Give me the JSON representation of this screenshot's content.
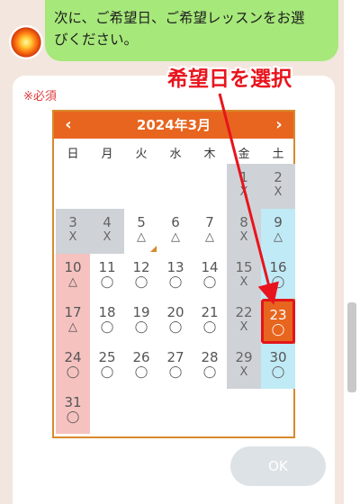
{
  "chat": {
    "message_line1": "次に、ご希望日、ご希望レッスンをお選",
    "message_line2": "びください。"
  },
  "annotation": {
    "text": "希望日を選択",
    "color": "#e8141d"
  },
  "form": {
    "required_label": "※必須"
  },
  "calendar": {
    "title": "2024年3月",
    "prev": "‹",
    "next": "›",
    "weekdays": [
      "日",
      "月",
      "火",
      "水",
      "木",
      "金",
      "土"
    ],
    "days": [
      {
        "d": "1",
        "m": "X",
        "row": 0,
        "col": 5,
        "state": "gray"
      },
      {
        "d": "2",
        "m": "X",
        "row": 0,
        "col": 6,
        "state": "gray"
      },
      {
        "d": "3",
        "m": "X",
        "row": 1,
        "col": 0,
        "state": "gray"
      },
      {
        "d": "4",
        "m": "X",
        "row": 1,
        "col": 1,
        "state": "gray"
      },
      {
        "d": "5",
        "m": "△",
        "row": 1,
        "col": 2,
        "state": "normal"
      },
      {
        "d": "6",
        "m": "△",
        "row": 1,
        "col": 3,
        "state": "normal"
      },
      {
        "d": "7",
        "m": "△",
        "row": 1,
        "col": 4,
        "state": "normal"
      },
      {
        "d": "8",
        "m": "X",
        "row": 1,
        "col": 5,
        "state": "gray"
      },
      {
        "d": "9",
        "m": "△",
        "row": 1,
        "col": 6,
        "state": "blue"
      },
      {
        "d": "10",
        "m": "△",
        "row": 2,
        "col": 0,
        "state": "pink"
      },
      {
        "d": "11",
        "m": "◯",
        "row": 2,
        "col": 1,
        "state": "normal"
      },
      {
        "d": "12",
        "m": "◯",
        "row": 2,
        "col": 2,
        "state": "normal"
      },
      {
        "d": "13",
        "m": "◯",
        "row": 2,
        "col": 3,
        "state": "normal"
      },
      {
        "d": "14",
        "m": "◯",
        "row": 2,
        "col": 4,
        "state": "normal"
      },
      {
        "d": "15",
        "m": "X",
        "row": 2,
        "col": 5,
        "state": "gray"
      },
      {
        "d": "16",
        "m": "◯",
        "row": 2,
        "col": 6,
        "state": "blue"
      },
      {
        "d": "17",
        "m": "△",
        "row": 3,
        "col": 0,
        "state": "pink"
      },
      {
        "d": "18",
        "m": "◯",
        "row": 3,
        "col": 1,
        "state": "normal"
      },
      {
        "d": "19",
        "m": "◯",
        "row": 3,
        "col": 2,
        "state": "normal"
      },
      {
        "d": "20",
        "m": "◯",
        "row": 3,
        "col": 3,
        "state": "normal"
      },
      {
        "d": "21",
        "m": "◯",
        "row": 3,
        "col": 4,
        "state": "normal"
      },
      {
        "d": "22",
        "m": "X",
        "row": 3,
        "col": 5,
        "state": "gray"
      },
      {
        "d": "23",
        "m": "◯",
        "row": 3,
        "col": 6,
        "state": "selected"
      },
      {
        "d": "24",
        "m": "◯",
        "row": 4,
        "col": 0,
        "state": "pink"
      },
      {
        "d": "25",
        "m": "◯",
        "row": 4,
        "col": 1,
        "state": "normal"
      },
      {
        "d": "26",
        "m": "◯",
        "row": 4,
        "col": 2,
        "state": "normal"
      },
      {
        "d": "27",
        "m": "◯",
        "row": 4,
        "col": 3,
        "state": "normal"
      },
      {
        "d": "28",
        "m": "◯",
        "row": 4,
        "col": 4,
        "state": "normal"
      },
      {
        "d": "29",
        "m": "X",
        "row": 4,
        "col": 5,
        "state": "gray"
      },
      {
        "d": "30",
        "m": "◯",
        "row": 4,
        "col": 6,
        "state": "blue"
      },
      {
        "d": "31",
        "m": "◯",
        "row": 5,
        "col": 0,
        "state": "pink"
      }
    ]
  },
  "buttons": {
    "ok_label": "OK"
  },
  "colors": {
    "header": "#e7651e",
    "border": "#d9892b",
    "bubble": "#a6e87a"
  }
}
